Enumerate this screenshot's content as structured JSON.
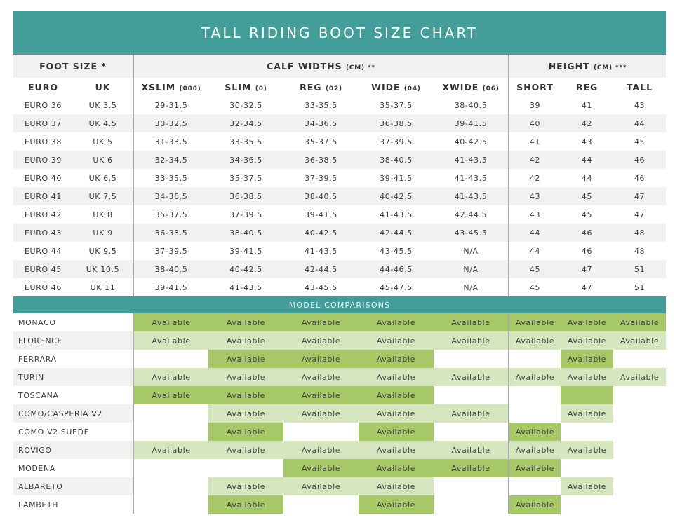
{
  "title": "TALL RIDING BOOT SIZE CHART",
  "groups": {
    "foot": "FOOT SIZE *",
    "calf": "CALF WIDTHS",
    "calf_unit": "(CM) **",
    "height": "HEIGHT",
    "height_unit": "(CM) ***"
  },
  "columns": {
    "euro": "EURO",
    "uk": "UK",
    "xslim": "XSLIM",
    "xslim_code": "(000)",
    "slim": "SLIM",
    "slim_code": "(0)",
    "reg": "REG",
    "reg_code": "(02)",
    "wide": "WIDE",
    "wide_code": "(04)",
    "xwide": "XWIDE",
    "xwide_code": "(06)",
    "short": "SHORT",
    "hreg": "REG",
    "tall": "TALL"
  },
  "size_rows": [
    [
      "EURO 36",
      "UK 3.5",
      "29-31.5",
      "30-32.5",
      "33-35.5",
      "35-37.5",
      "38-40.5",
      "39",
      "41",
      "43"
    ],
    [
      "EURO 37",
      "UK 4.5",
      "30-32.5",
      "32-34.5",
      "34-36.5",
      "36-38.5",
      "39-41.5",
      "40",
      "42",
      "44"
    ],
    [
      "EURO 38",
      "UK 5",
      "31-33.5",
      "33-35.5",
      "35-37.5",
      "37-39.5",
      "40-42.5",
      "41",
      "43",
      "45"
    ],
    [
      "EURO 39",
      "UK 6",
      "32-34.5",
      "34-36.5",
      "36-38.5",
      "38-40.5",
      "41-43.5",
      "42",
      "44",
      "46"
    ],
    [
      "EURO 40",
      "UK 6.5",
      "33-35.5",
      "35-37.5",
      "37-39.5",
      "39-41.5",
      "41-43.5",
      "42",
      "44",
      "46"
    ],
    [
      "EURO 41",
      "UK 7.5",
      "34-36.5",
      "36-38.5",
      "38-40.5",
      "40-42.5",
      "41-43.5",
      "43",
      "45",
      "47"
    ],
    [
      "EURO 42",
      "UK 8",
      "35-37.5",
      "37-39.5",
      "39-41.5",
      "41-43.5",
      "42.44.5",
      "43",
      "45",
      "47"
    ],
    [
      "EURO 43",
      "UK 9",
      "36-38.5",
      "38-40.5",
      "40-42.5",
      "42-44.5",
      "43-45.5",
      "44",
      "46",
      "48"
    ],
    [
      "EURO 44",
      "UK 9.5",
      "37-39.5",
      "39-41.5",
      "41-43.5",
      "43-45.5",
      "N/A",
      "44",
      "46",
      "48"
    ],
    [
      "EURO 45",
      "UK 10.5",
      "38-40.5",
      "40-42.5",
      "42-44.5",
      "44-46.5",
      "N/A",
      "45",
      "47",
      "51"
    ],
    [
      "EURO 46",
      "UK 11",
      "39-41.5",
      "41-43.5",
      "43-45.5",
      "45-47.5",
      "N/A",
      "45",
      "47",
      "51"
    ]
  ],
  "comparisons": {
    "label": "MODEL COMPARISONS",
    "available_text": "Available",
    "legend_note": "cells: d = available (dark green), l = available (light green), n = blank, e = empty dark green cell",
    "models": [
      {
        "name": "MONACO",
        "cells": [
          "d",
          "d",
          "d",
          "d",
          "d",
          "d",
          "d",
          "d"
        ]
      },
      {
        "name": "FLORENCE",
        "cells": [
          "l",
          "l",
          "l",
          "l",
          "l",
          "l",
          "l",
          "l"
        ]
      },
      {
        "name": "FERRARA",
        "cells": [
          "n",
          "d",
          "d",
          "d",
          "n",
          "n",
          "d",
          "n"
        ]
      },
      {
        "name": "TURIN",
        "cells": [
          "l",
          "l",
          "l",
          "l",
          "l",
          "l",
          "l",
          "l"
        ]
      },
      {
        "name": "TOSCANA",
        "cells": [
          "d",
          "d",
          "d",
          "d",
          "n",
          "n",
          "e",
          "n"
        ]
      },
      {
        "name": "COMO/CASPERIA V2",
        "cells": [
          "n",
          "l",
          "l",
          "l",
          "l",
          "n",
          "l",
          "n"
        ]
      },
      {
        "name": "COMO V2 SUEDE",
        "cells": [
          "n",
          "d",
          "n",
          "d",
          "n",
          "d",
          "n",
          "n"
        ]
      },
      {
        "name": "ROVIGO",
        "cells": [
          "l",
          "l",
          "l",
          "l",
          "l",
          "l",
          "l",
          "n"
        ]
      },
      {
        "name": "MODENA",
        "cells": [
          "n",
          "n",
          "d",
          "d",
          "d",
          "d",
          "n",
          "n"
        ]
      },
      {
        "name": "ALBARETO",
        "cells": [
          "n",
          "l",
          "l",
          "l",
          "n",
          "n",
          "l",
          "n"
        ]
      },
      {
        "name": "LAMBETH",
        "cells": [
          "n",
          "d",
          "n",
          "d",
          "n",
          "d",
          "n",
          "n"
        ]
      }
    ]
  },
  "colors": {
    "banner": "#439d99",
    "dark_available": "#a6c866",
    "light_available": "#d5e5be",
    "row_alt": "#f2f1ef",
    "divider": "#a8a8a8"
  }
}
